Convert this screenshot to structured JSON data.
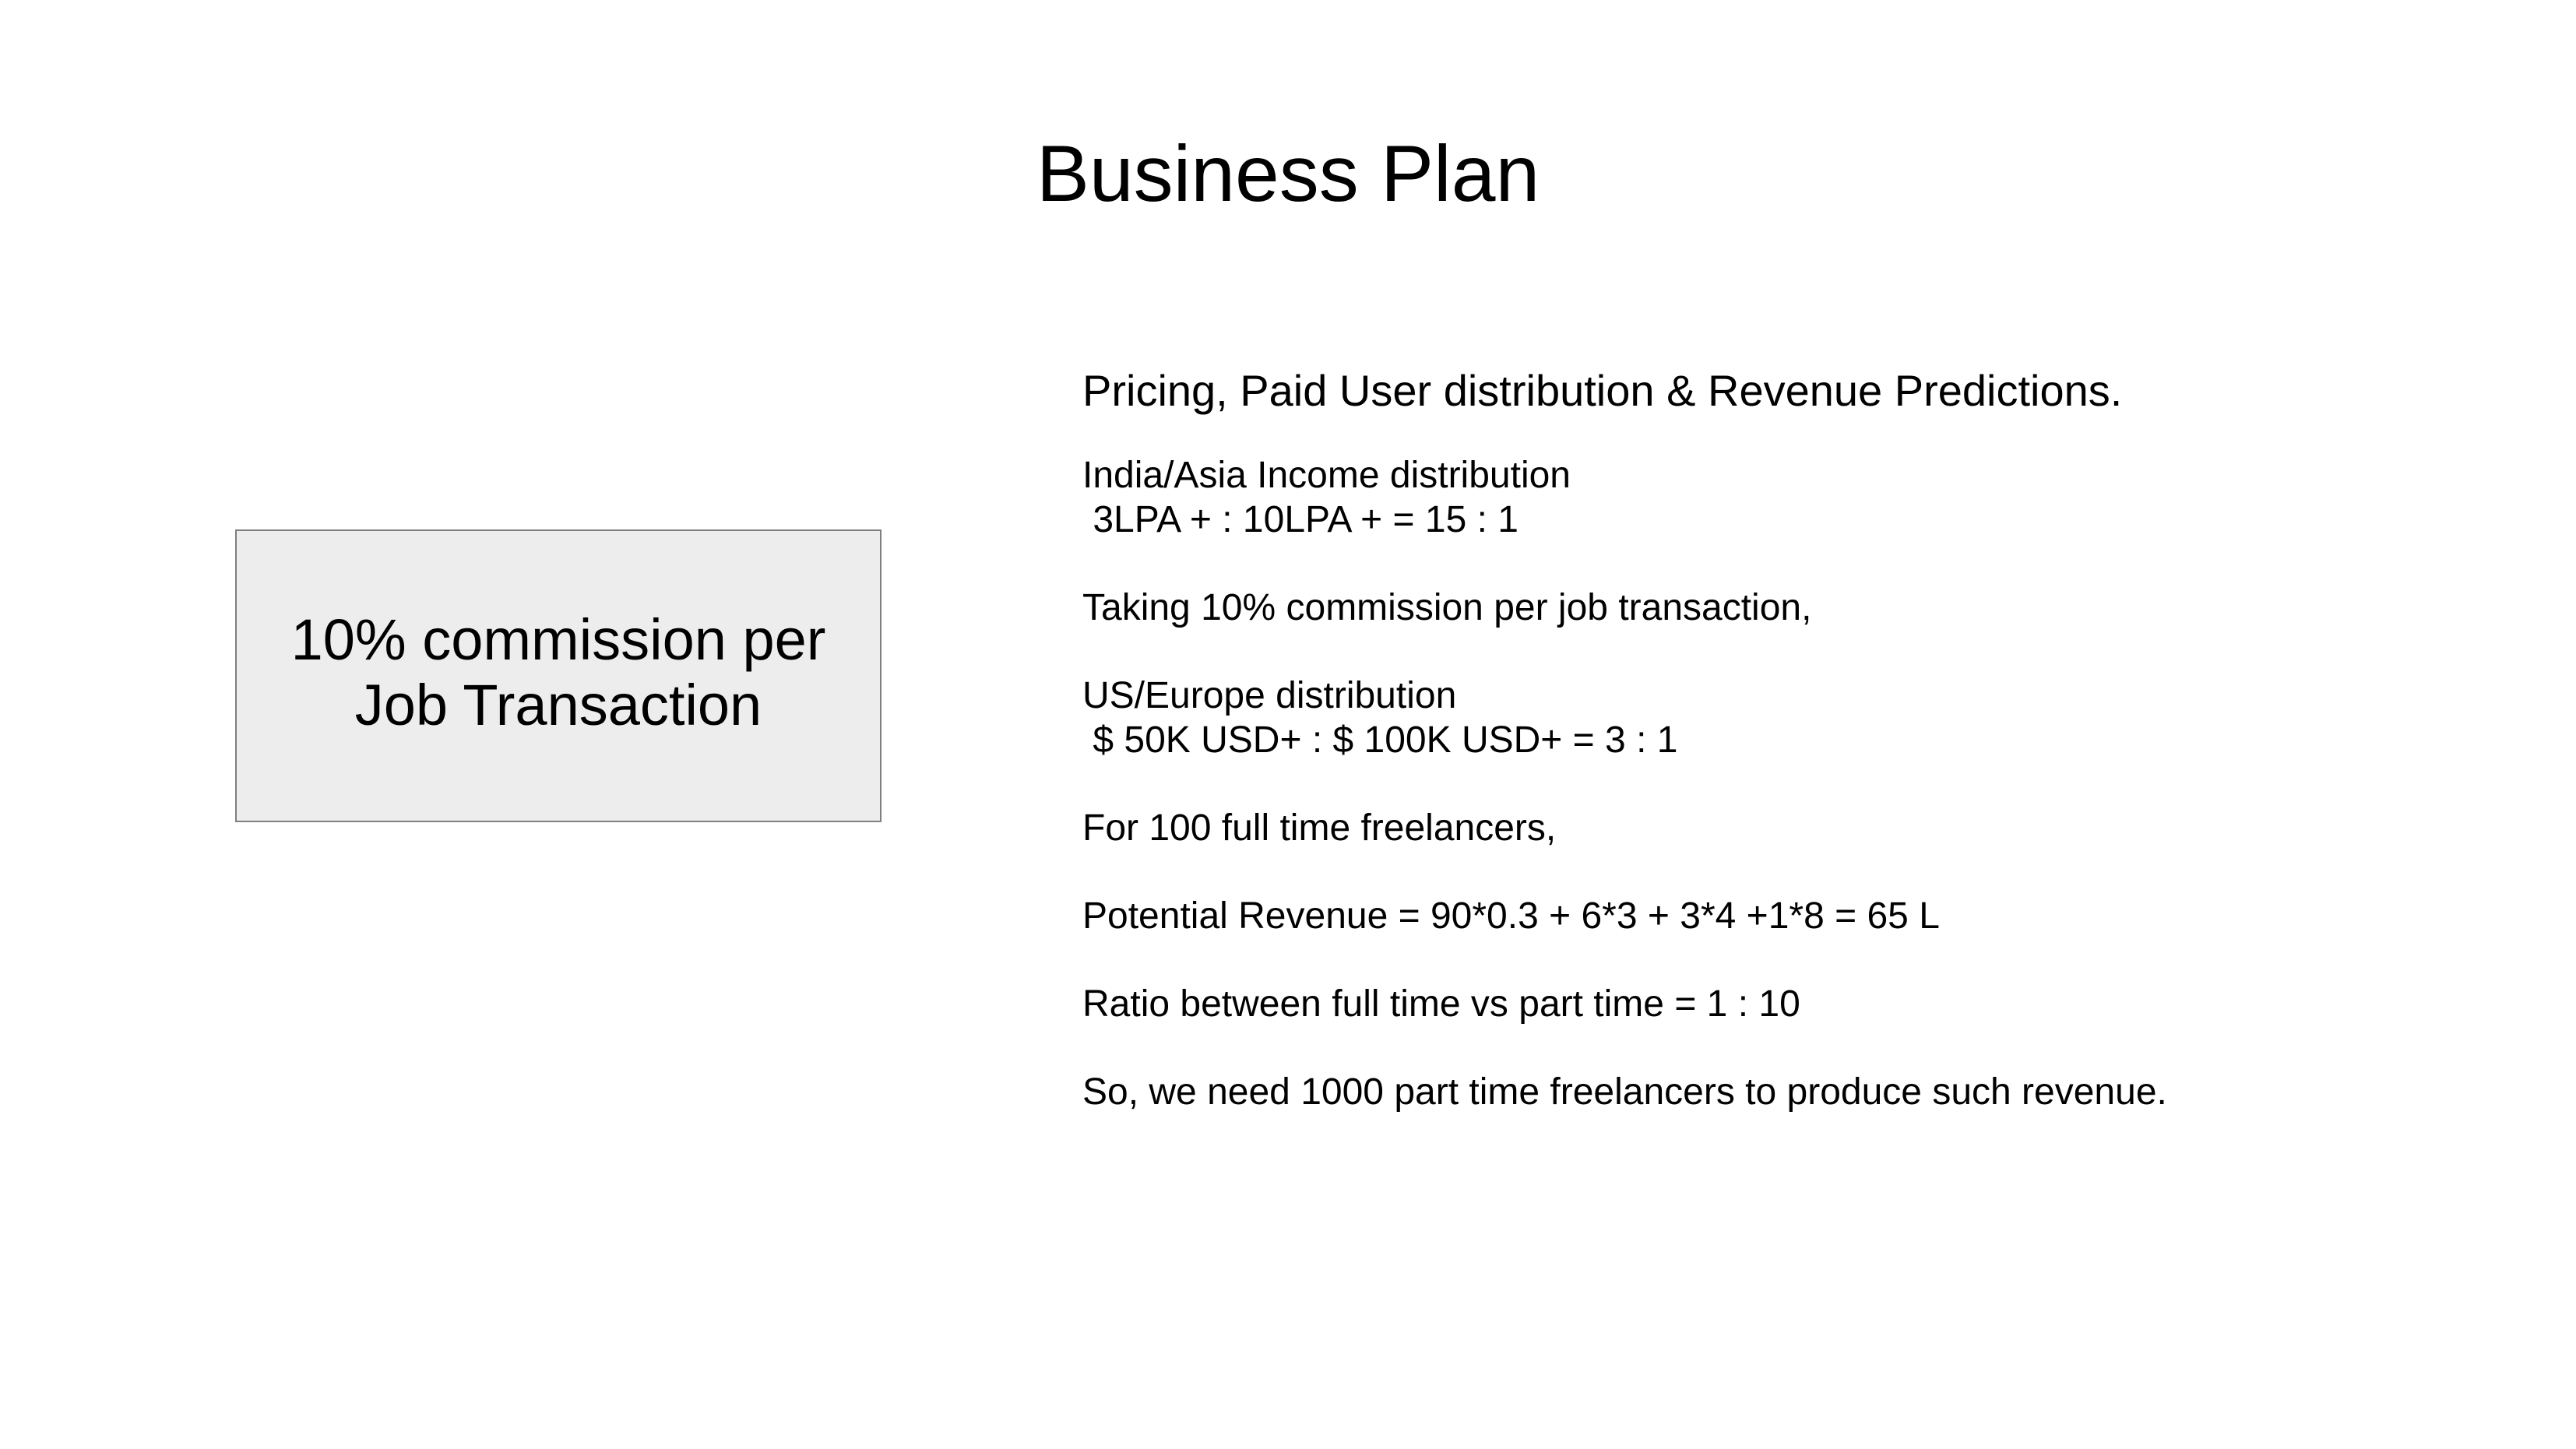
{
  "slide": {
    "title": "Business Plan",
    "callout": {
      "text": "10% commission per\nJob Transaction",
      "background": "#ededed",
      "border": "#7f7f7f"
    },
    "content": {
      "heading": "Pricing, Paid User distribution & Revenue Predictions.",
      "paragraphs": [
        "India/Asia Income distribution\n 3LPA + : 10LPA + = 15 : 1",
        "Taking 10% commission per job transaction,",
        "US/Europe distribution\n $ 50K USD+ : $ 100K USD+ = 3 : 1",
        "For 100 full time freelancers,",
        "Potential Revenue = 90*0.3 + 6*3 + 3*4 +1*8 = 65 L",
        "Ratio between full time vs part time = 1 : 10",
        "So, we need 1000 part time freelancers to produce such revenue."
      ]
    }
  }
}
